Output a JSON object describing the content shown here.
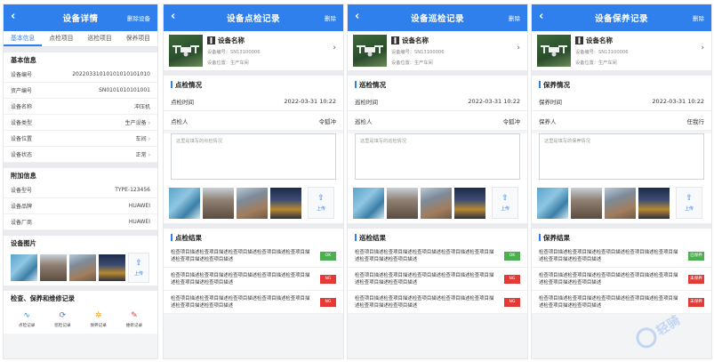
{
  "colors": {
    "primary": "#2f80ed",
    "ok": "#4caf50",
    "ng": "#e53935"
  },
  "s1": {
    "title": "设备详情",
    "del": "删除设备",
    "tabs": [
      "基本信息",
      "点检项目",
      "巡检项目",
      "保养项目"
    ],
    "basic_title": "基本信息",
    "basic": [
      {
        "k": "设备编号",
        "v": "20220331010101010101010"
      },
      {
        "k": "资产编号",
        "v": "SN0101010101001"
      },
      {
        "k": "设备名称",
        "v": "冲压机"
      },
      {
        "k": "设备类型",
        "v": "生产设备"
      },
      {
        "k": "设备位置",
        "v": "车间"
      },
      {
        "k": "设备状态",
        "v": "正常"
      }
    ],
    "extra_title": "附加信息",
    "extra": [
      {
        "k": "设备型号",
        "v": "TYPE-123456"
      },
      {
        "k": "设备品牌",
        "v": "HUAWEI"
      },
      {
        "k": "设备厂商",
        "v": "HUAWEI"
      }
    ],
    "photo_title": "设备图片",
    "upload": "上传",
    "record_title": "检查、保养和维修记录",
    "records": [
      "点检记录",
      "巡检记录",
      "保养记录",
      "维修记录"
    ]
  },
  "device": {
    "name": "设备名称",
    "sn_label": "设备编号：",
    "sn": "SN13100006",
    "loc_label": "设备位置：",
    "loc": "生产车间"
  },
  "upload": "上传",
  "desc_long": "检查项目描述检查项目描述检查项目描述检查项目描述检查项目描述检查项目描述检查项目描述",
  "s2": {
    "title": "设备点检记录",
    "del": "删除",
    "sec1": "点检情况",
    "time_k": "点检时间",
    "time_v": "2022-03-31 10:22",
    "person_k": "点检人",
    "person_v": "令狐冲",
    "placeholder": "这里是填写的点检情况",
    "sec2": "点检结果",
    "results": [
      "OK",
      "NG",
      "NG"
    ]
  },
  "s3": {
    "title": "设备巡检记录",
    "del": "删除",
    "sec1": "巡检情况",
    "time_k": "巡检时间",
    "time_v": "2022-03-31 10:22",
    "person_k": "巡检人",
    "person_v": "令狐冲",
    "placeholder": "这里是填写的巡检情况",
    "sec2": "巡检结果",
    "results": [
      "OK",
      "NG",
      "NG"
    ]
  },
  "s4": {
    "title": "设备保养记录",
    "del": "删除",
    "sec1": "保养情况",
    "time_k": "保养时间",
    "time_v": "2022-03-31 10:22",
    "person_k": "保养人",
    "person_v": "任我行",
    "placeholder": "这里是填写的保养情况",
    "sec2": "保养结果",
    "results": [
      "已保养",
      "未保养",
      "未保养"
    ]
  },
  "watermark": "轻骑"
}
